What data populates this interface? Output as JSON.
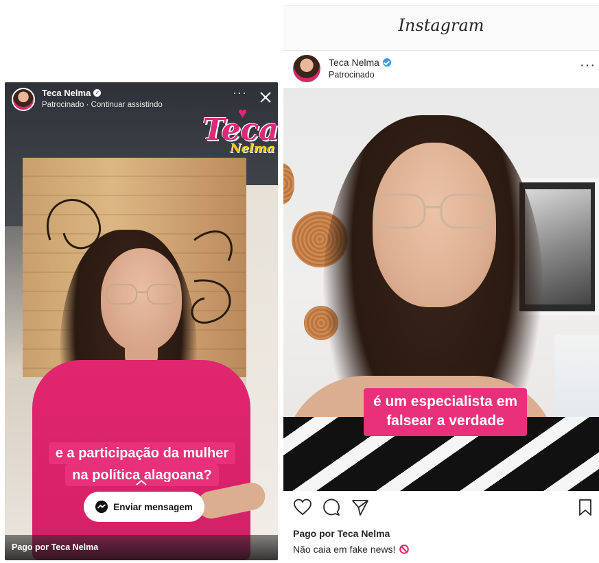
{
  "facebook_story": {
    "account_name": "Teca Nelma",
    "subtitle": "Patrocinado · Continuar assistindo",
    "more_label": "···",
    "logo_text": "Teca",
    "logo_subtext": "Nelma",
    "caption_line1": "e a participação da mulher",
    "caption_line2": "na política alagoana?",
    "send_message_label": "Enviar mensagem",
    "paid_by": "Pago por Teca Nelma",
    "colors": {
      "brand_pink": "#e8317a",
      "shirt": "#d41f66"
    }
  },
  "instagram_post": {
    "app_title": "Instagram",
    "account_name": "Teca Nelma",
    "sponsored": "Patrocinado",
    "more_label": "···",
    "caption_line1": "é um especialista em",
    "caption_line2": "falsear a verdade",
    "paid_by": "Pago por Teca Nelma",
    "post_text": "Não caia em fake news!",
    "icons": [
      "heart-icon",
      "comment-icon",
      "share-icon",
      "bookmark-icon",
      "no-entry-icon"
    ],
    "colors": {
      "verified": "#3897f0",
      "caption_bg": "#e8317a"
    }
  }
}
